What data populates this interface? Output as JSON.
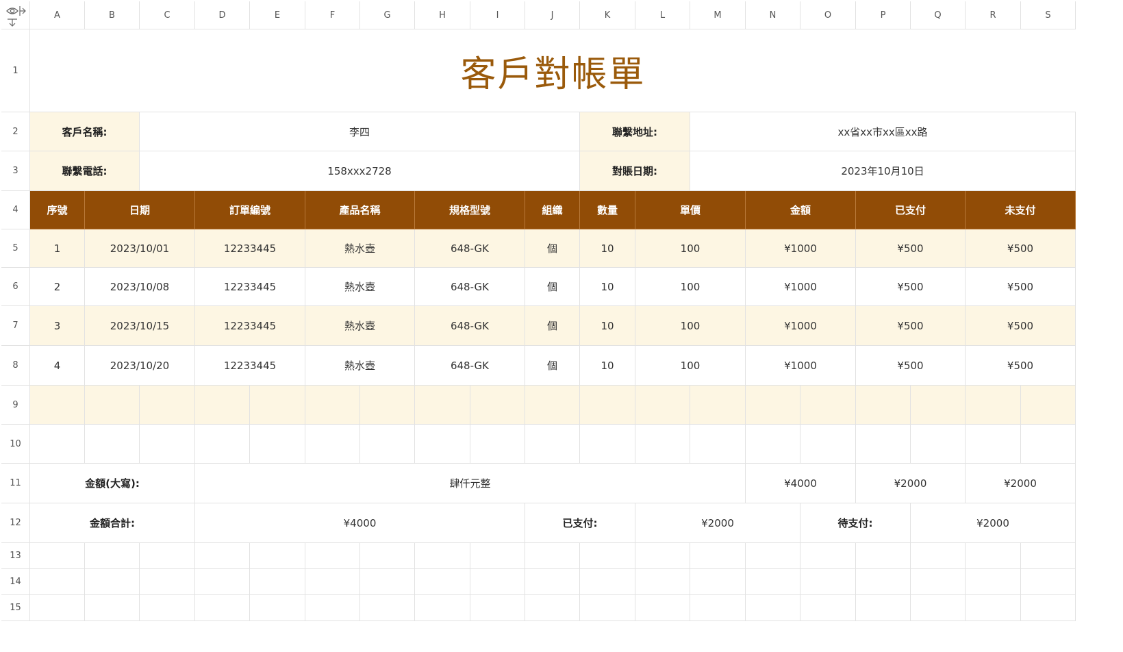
{
  "col_headers": [
    "A",
    "B",
    "C",
    "D",
    "E",
    "F",
    "G",
    "H",
    "I",
    "J",
    "K",
    "L",
    "M",
    "N",
    "O",
    "P",
    "Q",
    "R",
    "S"
  ],
  "row_headers": [
    "1",
    "2",
    "3",
    "4",
    "5",
    "6",
    "7",
    "8",
    "9",
    "10",
    "11",
    "12",
    "13",
    "14",
    "15"
  ],
  "corner_icon": "eye-icon",
  "title": "客戶對帳單",
  "info": {
    "customer_name_label": "客戶名稱:",
    "customer_name": "李四",
    "address_label": "聯繫地址:",
    "address": "xx省xx市xx區xx路",
    "phone_label": "聯繫電話:",
    "phone": "158xxx2728",
    "statement_date_label": "對賬日期:",
    "statement_date": "2023年10月10日"
  },
  "table": {
    "headers": [
      "序號",
      "日期",
      "訂單編號",
      "產品名稱",
      "規格型號",
      "組織",
      "數量",
      "單價",
      "金額",
      "已支付",
      "未支付"
    ],
    "rows": [
      [
        "1",
        "2023/10/01",
        "12233445",
        "熱水壺",
        "648-GK",
        "個",
        "10",
        "100",
        "¥1000",
        "¥500",
        "¥500"
      ],
      [
        "2",
        "2023/10/08",
        "12233445",
        "熱水壺",
        "648-GK",
        "個",
        "10",
        "100",
        "¥1000",
        "¥500",
        "¥500"
      ],
      [
        "3",
        "2023/10/15",
        "12233445",
        "熱水壺",
        "648-GK",
        "個",
        "10",
        "100",
        "¥1000",
        "¥500",
        "¥500"
      ],
      [
        "4",
        "2023/10/20",
        "12233445",
        "熱水壺",
        "648-GK",
        "個",
        "10",
        "100",
        "¥1000",
        "¥500",
        "¥500"
      ]
    ]
  },
  "summary": {
    "amount_words_label": "金額(大寫):",
    "amount_words": "肆仟元整",
    "total_amount_col": "¥4000",
    "total_paid_col": "¥2000",
    "total_unpaid_col": "¥2000",
    "total_label": "金額合計:",
    "total_value": "¥4000",
    "paid_label": "已支付:",
    "paid_value": "¥2000",
    "pending_label": "待支付:",
    "pending_value": "¥2000"
  },
  "colors": {
    "accent": "#914c06",
    "title": "#9a5a0b",
    "cream": "#fdf6e3",
    "grid": "#e2e2e2"
  }
}
